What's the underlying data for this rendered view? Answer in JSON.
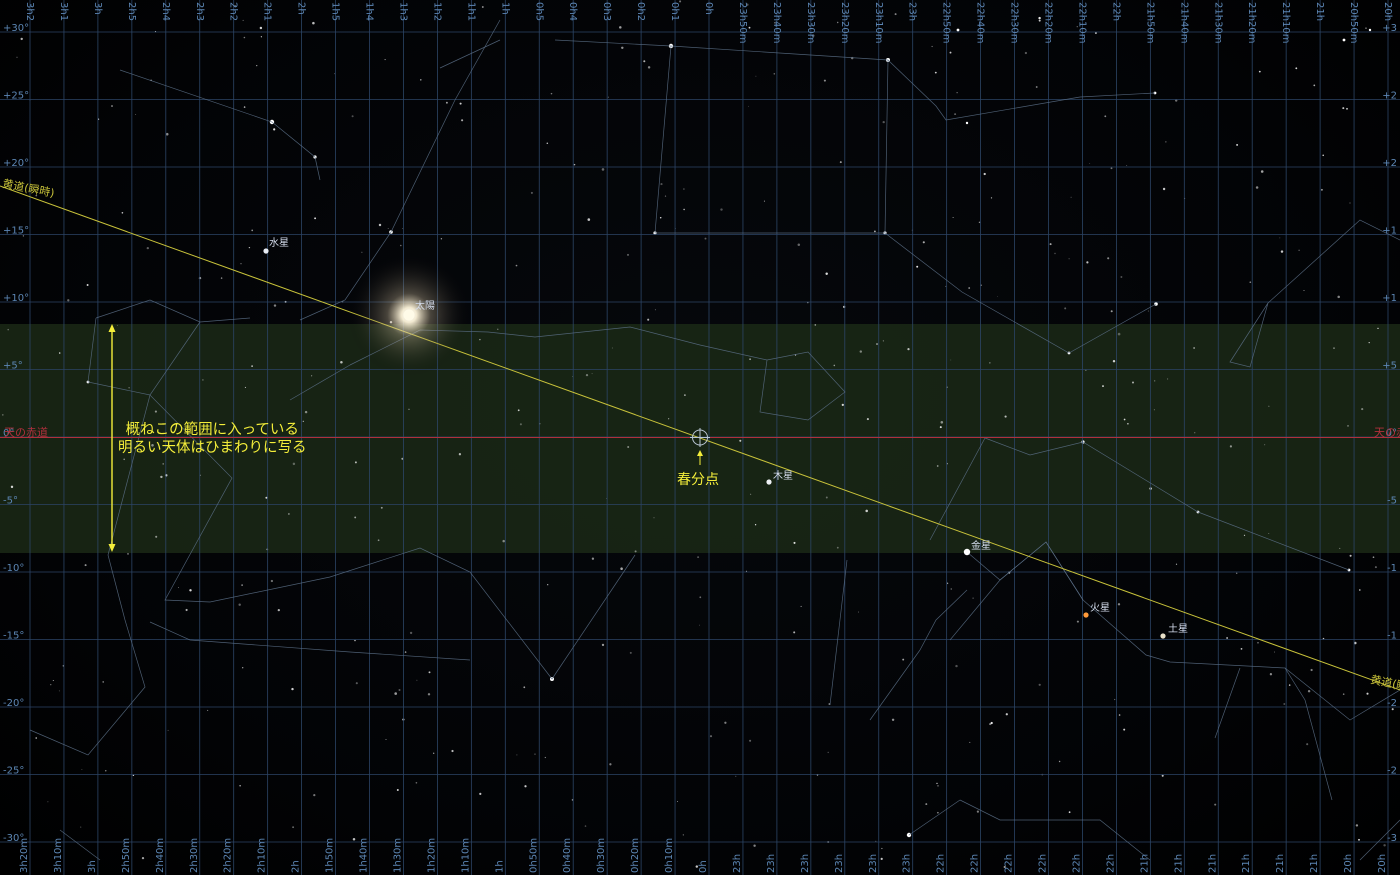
{
  "app": {
    "view": "Stellarium sky chart"
  },
  "colors": {
    "grid": "#2c4566",
    "ecliptic": "#c8c23a",
    "equator": "#b0303c",
    "band": "#1a2a16",
    "constellation_lines": "#5a6f86",
    "annotation": "#f4ee3a",
    "planet_label": "#d4dcec"
  },
  "top_ra_labels": [
    "3h2",
    "3h1",
    "3h",
    "2h5",
    "2h4",
    "2h3",
    "2h2",
    "2h1",
    "2h",
    "1h5",
    "1h4",
    "1h3",
    "1h2",
    "1h1",
    "1h",
    "0h5",
    "0h4",
    "0h3",
    "0h2",
    "0h1",
    "0h",
    "23h50m",
    "23h40m",
    "23h30m",
    "23h20m",
    "23h10m",
    "23h",
    "22h50m",
    "22h40m",
    "22h30m",
    "22h20m",
    "22h10m",
    "22h",
    "21h50m",
    "21h40m",
    "21h30m",
    "21h20m",
    "21h10m",
    "21h",
    "20h50m",
    "20h"
  ],
  "bottom_ra_labels": [
    "3h20m",
    "3h10m",
    "3h",
    "2h50m",
    "2h40m",
    "2h30m",
    "2h20m",
    "2h10m",
    "2h",
    "1h50m",
    "1h40m",
    "1h30m",
    "1h20m",
    "1h10m",
    "1h",
    "0h50m",
    "0h40m",
    "0h30m",
    "0h20m",
    "0h10m",
    "0h",
    "23h",
    "23h",
    "23h",
    "23h",
    "23h",
    "23h",
    "22h",
    "22h",
    "22h",
    "22h",
    "22h",
    "22h",
    "21h",
    "21h",
    "21h",
    "21h",
    "21h",
    "21h",
    "20h",
    "20h"
  ],
  "dec_labels_left": [
    "+30°",
    "+25°",
    "+20°",
    "+15°",
    "+10°",
    "+5°",
    "0°",
    "-5°",
    "-10°",
    "-15°",
    "-20°",
    "-25°",
    "-30°"
  ],
  "dec_labels_right": [
    "+3",
    "+2",
    "+2",
    "+1",
    "+1",
    "+5",
    "0°",
    "-5",
    "-1",
    "-1",
    "-2",
    "-2",
    "-3"
  ],
  "lines": {
    "ecliptic_left": "黄道(瞬時)",
    "ecliptic_right": "黄道(瞬",
    "equator_left": "天の赤道",
    "equator_right": "天の赤"
  },
  "planets": [
    {
      "name": "水星",
      "color": "#e8ecf4"
    },
    {
      "name": "太陽",
      "color": "#fffbe8"
    },
    {
      "name": "木星",
      "color": "#eef0f4"
    },
    {
      "name": "金星",
      "color": "#ffffff"
    },
    {
      "name": "火星",
      "color": "#ff9a3a"
    },
    {
      "name": "土星",
      "color": "#e8e0c8"
    }
  ],
  "annotation": {
    "line1": "概ねこの範囲に入っている",
    "line2": "明るい天体はひまわりに写る"
  },
  "vernal_equinox": {
    "label": "春分点"
  }
}
